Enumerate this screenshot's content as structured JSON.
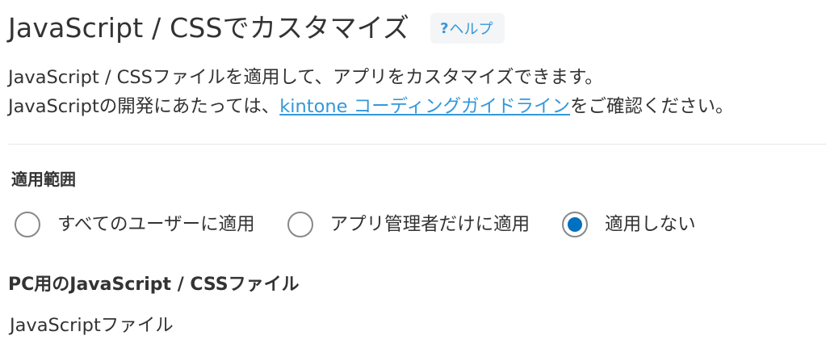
{
  "header": {
    "title": "JavaScript / CSSでカスタマイズ",
    "help_icon": "?",
    "help_label": "ヘルプ"
  },
  "description": {
    "line1": "JavaScript / CSSファイルを適用して、アプリをカスタマイズできます。",
    "line2_prefix": "JavaScriptの開発にあたっては、",
    "line2_link": "kintone コーディングガイドライン",
    "line2_suffix": "をご確認ください。"
  },
  "scope": {
    "heading": "適用範囲",
    "options": [
      {
        "label": "すべてのユーザーに適用",
        "checked": false
      },
      {
        "label": "アプリ管理者だけに適用",
        "checked": false
      },
      {
        "label": "適用しない",
        "checked": true
      }
    ]
  },
  "pc_section": {
    "heading": "PC用のJavaScript / CSSファイル",
    "js_files_label": "JavaScriptファイル"
  },
  "colors": {
    "accent": "#3498db",
    "radio_selected": "#0070c0",
    "text": "#333333",
    "divider": "#e3e7e8"
  },
  "icons": {
    "help": "question-mark-icon"
  }
}
